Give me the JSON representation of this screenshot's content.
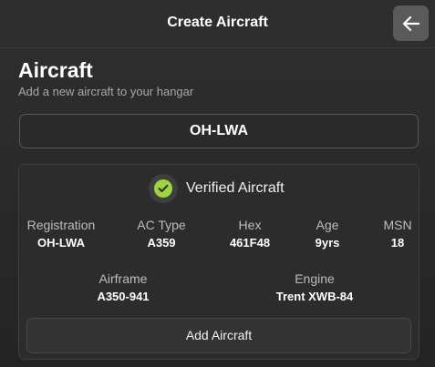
{
  "header": {
    "title": "Create Aircraft",
    "back_icon": "arrow-left-icon"
  },
  "section": {
    "title": "Aircraft",
    "subtitle": "Add a new aircraft to your hangar"
  },
  "registration_input": {
    "value": "OH-LWA"
  },
  "card": {
    "verified_icon": "check-circle-icon",
    "verified_label": "Verified Aircraft",
    "stats": {
      "registration": {
        "label": "Registration",
        "value": "OH-LWA"
      },
      "ac_type": {
        "label": "AC Type",
        "value": "A359"
      },
      "hex": {
        "label": "Hex",
        "value": "461F48"
      },
      "age": {
        "label": "Age",
        "value": "9yrs"
      },
      "msn": {
        "label": "MSN",
        "value": "18"
      },
      "airframe": {
        "label": "Airframe",
        "value": "A350-941"
      },
      "engine": {
        "label": "Engine",
        "value": "Trent XWB-84"
      }
    },
    "add_button_label": "Add Aircraft"
  },
  "colors": {
    "background": "#252525",
    "verified_green": "#9cd63a",
    "muted_text": "#a8a8a8"
  }
}
